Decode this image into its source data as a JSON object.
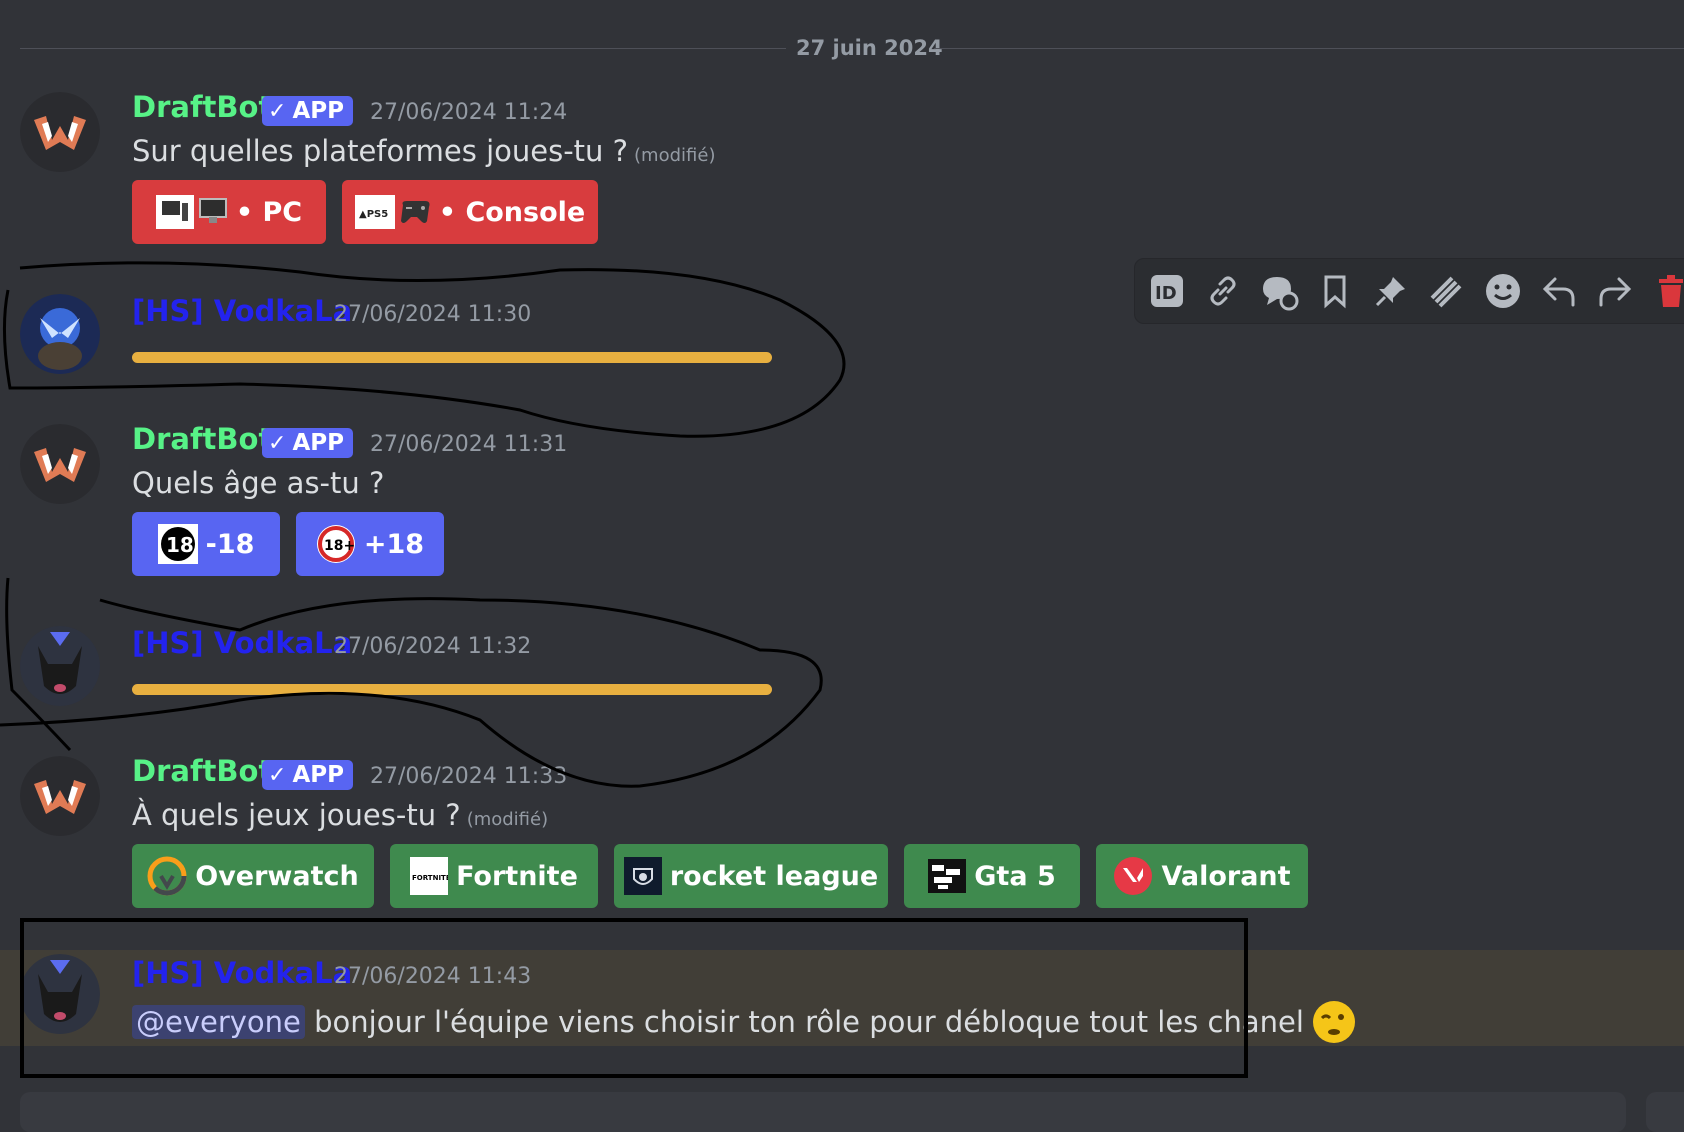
{
  "divider": {
    "date": "27 juin 2024"
  },
  "messages": [
    {
      "author": "DraftBot",
      "tag": "APP",
      "timestamp": "27/06/2024 11:24",
      "text": "Sur quelles plateformes joues-tu ?",
      "edited": "(modifié)",
      "buttons": [
        {
          "label": "• PC",
          "icon": "pc-monitor-icon"
        },
        {
          "label": "• Console",
          "icon": "gamepad-icon"
        }
      ]
    },
    {
      "author": "[HS] VodkaLa",
      "timestamp": "27/06/2024 11:30"
    },
    {
      "author": "DraftBot",
      "tag": "APP",
      "timestamp": "27/06/2024 11:31",
      "text": "Quels âge as-tu ?",
      "buttons": [
        {
          "label": "-18",
          "icon": "under-18-icon",
          "badge": "18"
        },
        {
          "label": "+18",
          "icon": "over-18-icon",
          "badge": "18+"
        }
      ]
    },
    {
      "author": "[HS] VodkaLa",
      "timestamp": "27/06/2024 11:32"
    },
    {
      "author": "DraftBot",
      "tag": "APP",
      "timestamp": "27/06/2024 11:33",
      "text": "À quels jeux joues-tu ?",
      "edited": "(modifié)",
      "buttons": [
        {
          "label": "Overwatch",
          "icon": "overwatch-icon"
        },
        {
          "label": "Fortnite",
          "icon": "fortnite-icon",
          "badge": "FORTNITE"
        },
        {
          "label": "rocket league",
          "icon": "rocket-league-icon"
        },
        {
          "label": "Gta 5",
          "icon": "gta-icon"
        },
        {
          "label": "Valorant",
          "icon": "valorant-icon"
        }
      ]
    },
    {
      "author": "[HS] VodkaLa",
      "timestamp": "27/06/2024 11:43",
      "mention": "@everyone",
      "text": " bonjour l'équipe viens choisir ton rôle pour débloque tout les chanel",
      "emoji": "winking-face-emoji"
    }
  ],
  "toolbar": {
    "icons": [
      "id-icon",
      "link-icon",
      "thread-icon",
      "bookmark-icon",
      "pin-icon",
      "mark-unread-icon",
      "emoji-icon",
      "reply-icon",
      "forward-icon",
      "delete-icon"
    ]
  },
  "colors": {
    "background": "#313338",
    "bot_name": "#57f287",
    "user_name": "#2323ee",
    "app_tag": "#5865f2",
    "button_red": "#d83c3e",
    "button_blue": "#5865f2",
    "button_green": "#3f8a4e",
    "redaction_bar": "#e8b040",
    "highlight_row": "#413e37",
    "annotation": "#000000"
  }
}
